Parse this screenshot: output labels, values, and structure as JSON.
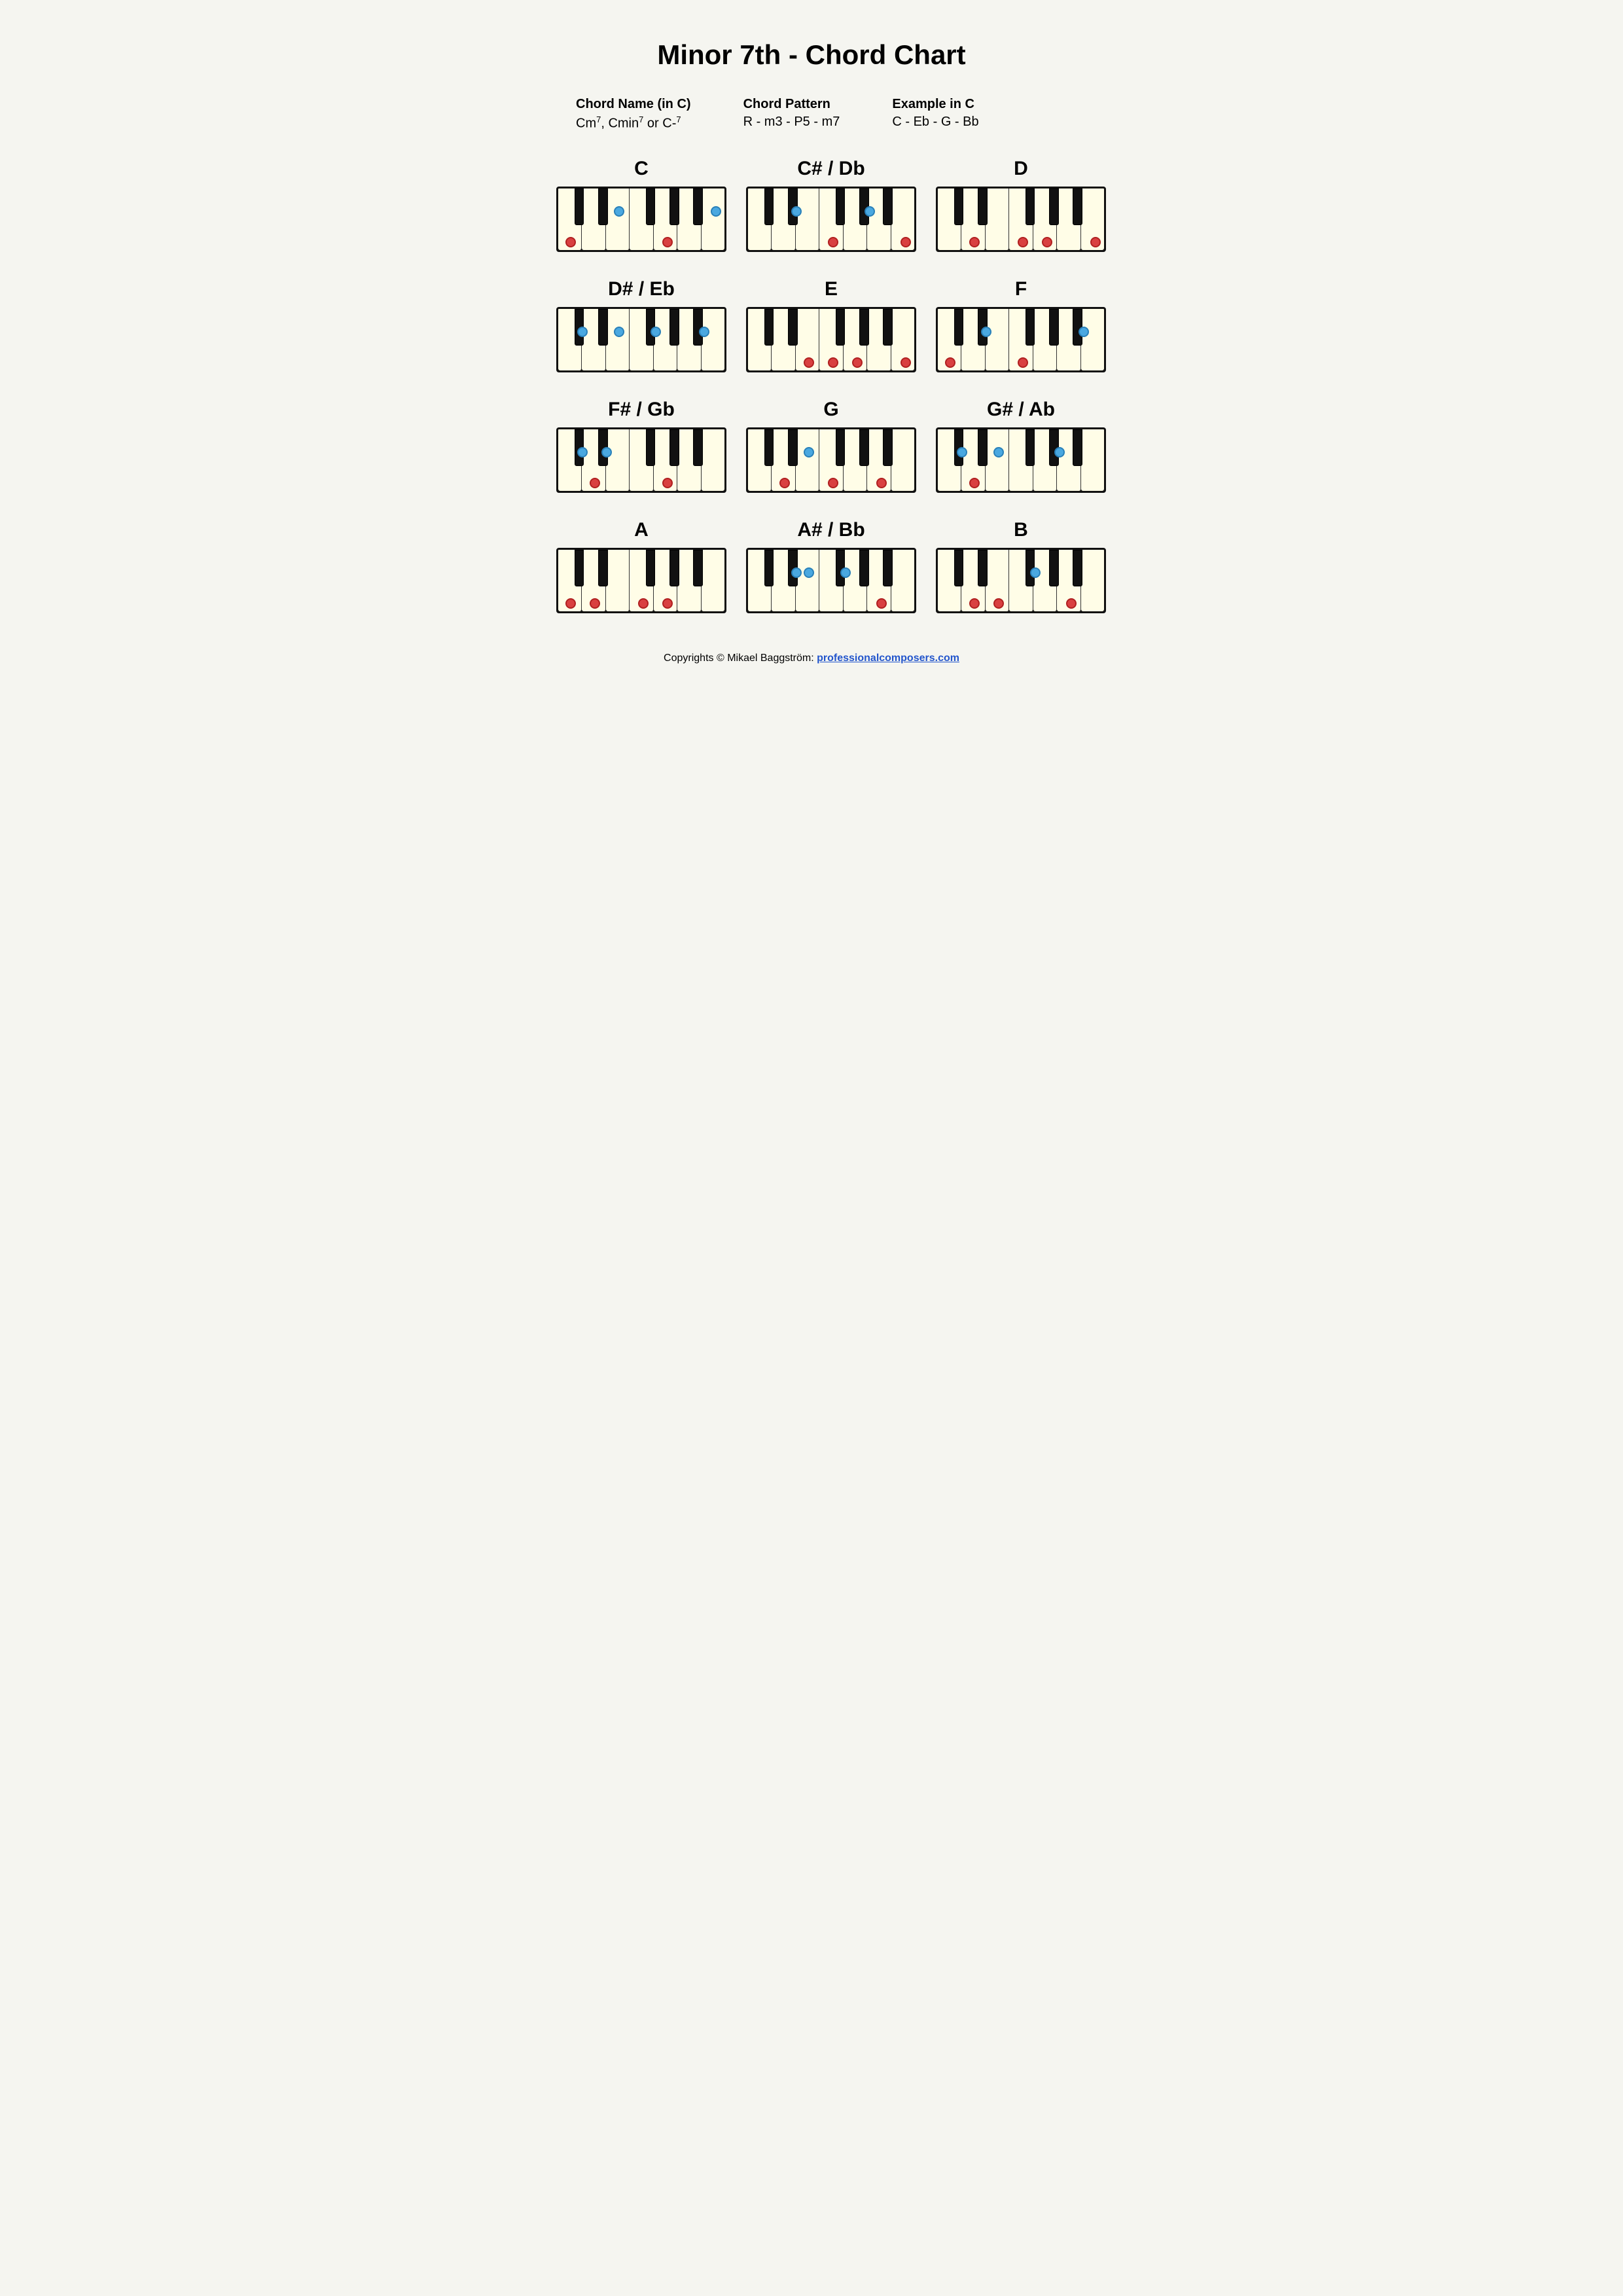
{
  "title": "Minor 7th - Chord Chart",
  "info": {
    "chord_name_label": "Chord Name (in C)",
    "chord_name_value": "Cm⁷, Cmin⁷ or C-⁷",
    "pattern_label": "Chord Pattern",
    "pattern_value": "R - m3 - P5 - m7",
    "example_label": "Example in C",
    "example_value": "C - Eb - G - Bb"
  },
  "chords": [
    {
      "id": "C",
      "name": "C",
      "dots": [
        {
          "type": "red",
          "wk": 0,
          "bottom": true
        },
        {
          "type": "blue",
          "wk": 2,
          "bottom": false
        },
        {
          "type": "red",
          "wk": 4,
          "bottom": true
        },
        {
          "type": "blue",
          "wk": 6,
          "bottom": false
        }
      ]
    },
    {
      "id": "Csharp",
      "name": "C# / Db",
      "dots": [
        {
          "type": "blue",
          "wk": 1,
          "bottom": false
        },
        {
          "type": "red",
          "wk": 3,
          "bottom": true
        },
        {
          "type": "blue",
          "wk": 4,
          "bottom": false
        },
        {
          "type": "red",
          "wk": 6,
          "bottom": true
        }
      ]
    },
    {
      "id": "D",
      "name": "D",
      "dots": [
        {
          "type": "red",
          "wk": 1,
          "bottom": true
        },
        {
          "type": "red",
          "wk": 3,
          "bottom": true
        },
        {
          "type": "red",
          "wk": 4,
          "bottom": true
        },
        {
          "type": "red",
          "wk": 6,
          "bottom": true
        }
      ]
    },
    {
      "id": "Dsharp",
      "name": "D# / Eb",
      "dots": [
        {
          "type": "blue",
          "wk": 0,
          "bottom": false
        },
        {
          "type": "blue",
          "wk": 2,
          "bottom": false
        },
        {
          "type": "blue",
          "wk": 3,
          "bottom": false
        },
        {
          "type": "blue",
          "wk": 5,
          "bottom": false
        }
      ]
    },
    {
      "id": "E",
      "name": "E",
      "dots": [
        {
          "type": "red",
          "wk": 2,
          "bottom": true
        },
        {
          "type": "red",
          "wk": 3,
          "bottom": true
        },
        {
          "type": "red",
          "wk": 4,
          "bottom": true
        },
        {
          "type": "red",
          "wk": 6,
          "bottom": true
        }
      ]
    },
    {
      "id": "F",
      "name": "F",
      "dots": [
        {
          "type": "red",
          "wk": 0,
          "bottom": true
        },
        {
          "type": "blue",
          "wk": 1,
          "bottom": false
        },
        {
          "type": "red",
          "wk": 3,
          "bottom": true
        },
        {
          "type": "blue",
          "wk": 5,
          "bottom": false
        }
      ]
    },
    {
      "id": "Fsharp",
      "name": "F# / Gb",
      "dots": [
        {
          "type": "blue",
          "wk": 0,
          "bottom": false
        },
        {
          "type": "blue",
          "wk": 1,
          "bottom": false
        },
        {
          "type": "red",
          "wk": 1,
          "bottom": true
        },
        {
          "type": "red",
          "wk": 4,
          "bottom": true
        }
      ]
    },
    {
      "id": "G",
      "name": "G",
      "dots": [
        {
          "type": "red",
          "wk": 1,
          "bottom": true
        },
        {
          "type": "blue",
          "wk": 2,
          "bottom": false
        },
        {
          "type": "red",
          "wk": 3,
          "bottom": true
        },
        {
          "type": "red",
          "wk": 5,
          "bottom": true
        }
      ]
    },
    {
      "id": "Gsharp",
      "name": "G# / Ab",
      "dots": [
        {
          "type": "blue",
          "wk": 0,
          "bottom": false
        },
        {
          "type": "red",
          "wk": 1,
          "bottom": true
        },
        {
          "type": "blue",
          "wk": 2,
          "bottom": false
        },
        {
          "type": "blue",
          "wk": 4,
          "bottom": false
        }
      ]
    },
    {
      "id": "A",
      "name": "A",
      "dots": [
        {
          "type": "red",
          "wk": 0,
          "bottom": true
        },
        {
          "type": "red",
          "wk": 1,
          "bottom": true
        },
        {
          "type": "red",
          "wk": 3,
          "bottom": true
        },
        {
          "type": "red",
          "wk": 4,
          "bottom": true
        }
      ]
    },
    {
      "id": "Asharp",
      "name": "A# / Bb",
      "dots": [
        {
          "type": "blue",
          "wk": 1,
          "bottom": false
        },
        {
          "type": "blue",
          "wk": 2,
          "bottom": false
        },
        {
          "type": "blue",
          "wk": 3,
          "bottom": false
        },
        {
          "type": "red",
          "wk": 5,
          "bottom": true
        }
      ]
    },
    {
      "id": "B",
      "name": "B",
      "dots": [
        {
          "type": "red",
          "wk": 1,
          "bottom": true
        },
        {
          "type": "red",
          "wk": 2,
          "bottom": true
        },
        {
          "type": "blue",
          "wk": 3,
          "bottom": false
        },
        {
          "type": "red",
          "wk": 5,
          "bottom": true
        }
      ]
    }
  ],
  "footer": {
    "text": "Copyrights © Mikael Baggström: ",
    "link_text": "professionalcomposers.com",
    "link_href": "https://professionalcomposers.com"
  }
}
